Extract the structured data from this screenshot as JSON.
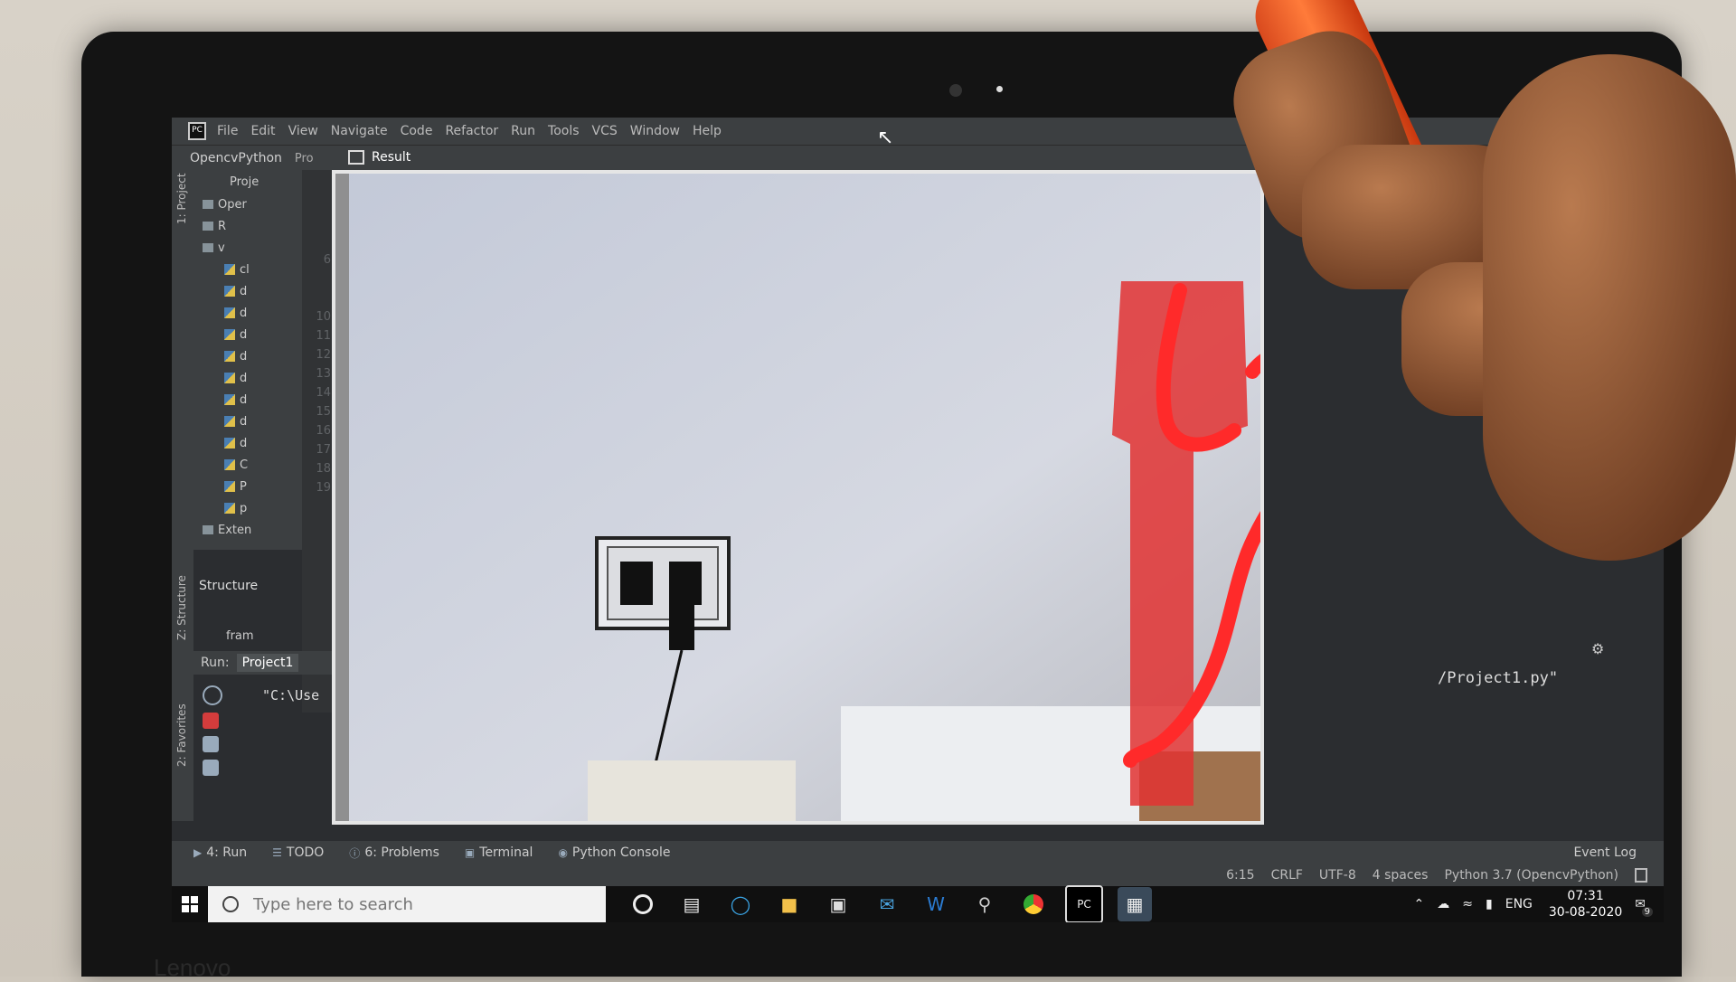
{
  "device": {
    "brand": "Lenovo"
  },
  "ide": {
    "menu": [
      "File",
      "Edit",
      "View",
      "Navigate",
      "Code",
      "Refactor",
      "Run",
      "Tools",
      "VCS",
      "Window",
      "Help"
    ],
    "project_name": "OpencvPython",
    "breadcrumb_short": "Pro",
    "project_label": "1: Project",
    "project_panel_header": "Proje",
    "tree": [
      {
        "type": "folder",
        "label": "Oper"
      },
      {
        "type": "folder",
        "label": "R"
      },
      {
        "type": "folder",
        "label": "v"
      },
      {
        "type": "file",
        "label": "cl"
      },
      {
        "type": "file",
        "label": "d"
      },
      {
        "type": "file",
        "label": "d"
      },
      {
        "type": "file",
        "label": "d"
      },
      {
        "type": "file",
        "label": "d"
      },
      {
        "type": "file",
        "label": "d"
      },
      {
        "type": "file",
        "label": "d"
      },
      {
        "type": "file",
        "label": "d"
      },
      {
        "type": "file",
        "label": "d"
      },
      {
        "type": "file",
        "label": "C"
      },
      {
        "type": "file",
        "label": "P"
      },
      {
        "type": "file",
        "label": "p"
      },
      {
        "type": "folder",
        "label": "Exten"
      }
    ],
    "line_numbers": [
      "6",
      "",
      "",
      "10",
      "11",
      "12",
      "13",
      "14",
      "15",
      "16",
      "17",
      "18",
      "19"
    ],
    "structure_label": "Structure",
    "side_labels": {
      "structure": "Z: Structure",
      "favorites": "2: Favorites"
    },
    "frame_label": "fram",
    "run": {
      "label": "Run:",
      "tab": "Project1",
      "console_path": "\"C:\\Use",
      "console_right": "/Project1.py\""
    },
    "bottom_tabs": [
      "4: Run",
      "TODO",
      "6: Problems",
      "Terminal",
      "Python Console"
    ],
    "event_log": "Event Log",
    "status": [
      "6:15",
      "CRLF",
      "UTF-8",
      "4 spaces",
      "Python 3.7 (OpencvPython)"
    ]
  },
  "result_window": {
    "title": "Result"
  },
  "taskbar": {
    "search_placeholder": "Type here to search",
    "language": "ENG",
    "time": "07:31",
    "date": "30-08-2020",
    "notification_count": "9",
    "icons": [
      "cortana-icon",
      "task-view-icon",
      "edge-icon",
      "file-explorer-icon",
      "store-icon",
      "mail-icon",
      "word-icon",
      "maps-icon",
      "chrome-icon",
      "pycharm-icon",
      "app-window-icon"
    ]
  },
  "colors": {
    "drawing": "#ff2a2a",
    "marker": "#ff6a2a",
    "ide_bg": "#2b2d30"
  }
}
